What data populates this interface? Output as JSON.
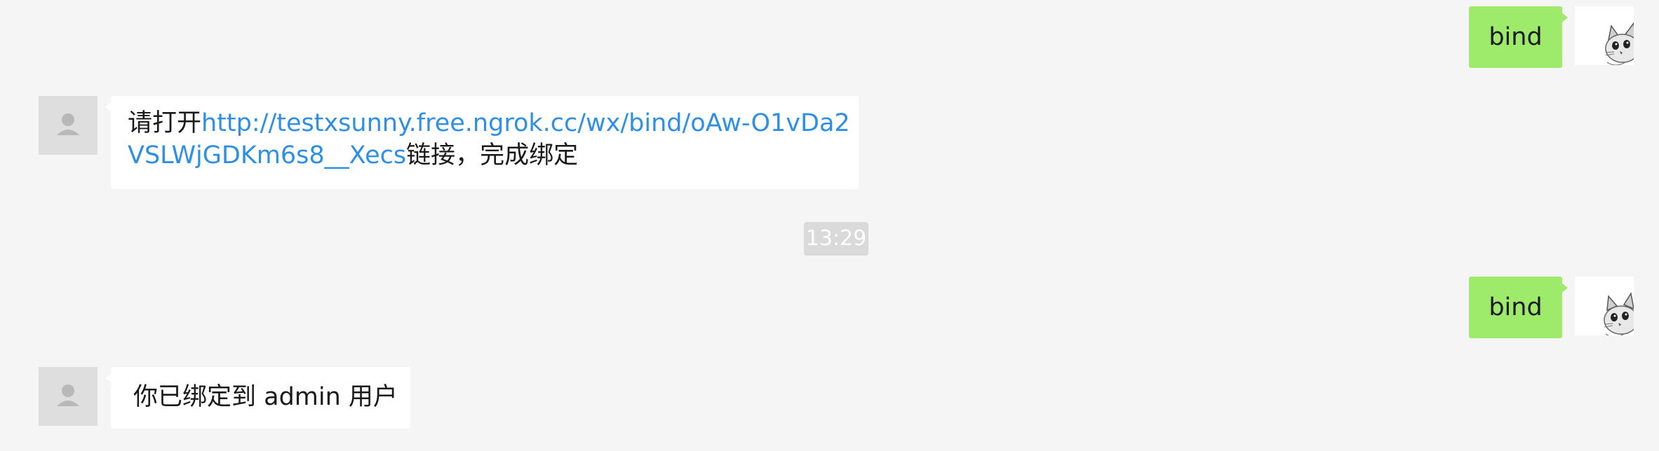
{
  "conversation": {
    "messages": [
      {
        "side": "sent",
        "text": "bind"
      },
      {
        "side": "received",
        "text_prefix": "请打开",
        "link_text": "http://testxsunny.free.ngrok.cc/wx/bind/oAw-O1vDa2VSLWjGDKm6s8__Xecs",
        "link_line1": "http://testxsunny.free.ngrok.cc/wx/bind/oAw-O1vDa2",
        "link_line2": "VSLWjGDKm6s8__Xecs",
        "text_suffix": "链接，完成绑定"
      },
      {
        "side": "system",
        "time": "13:29"
      },
      {
        "side": "sent",
        "text": "bind"
      },
      {
        "side": "received",
        "text": "你已绑定到 admin 用户"
      }
    ],
    "icons": {
      "default_avatar": "user-silhouette-icon",
      "self_avatar": "cat-avatar-icon"
    },
    "colors": {
      "background": "#f5f5f5",
      "sent_bubble": "#9eea6a",
      "received_bubble": "#ffffff",
      "link": "#2e8fe8",
      "time_badge": "#dadada"
    }
  }
}
